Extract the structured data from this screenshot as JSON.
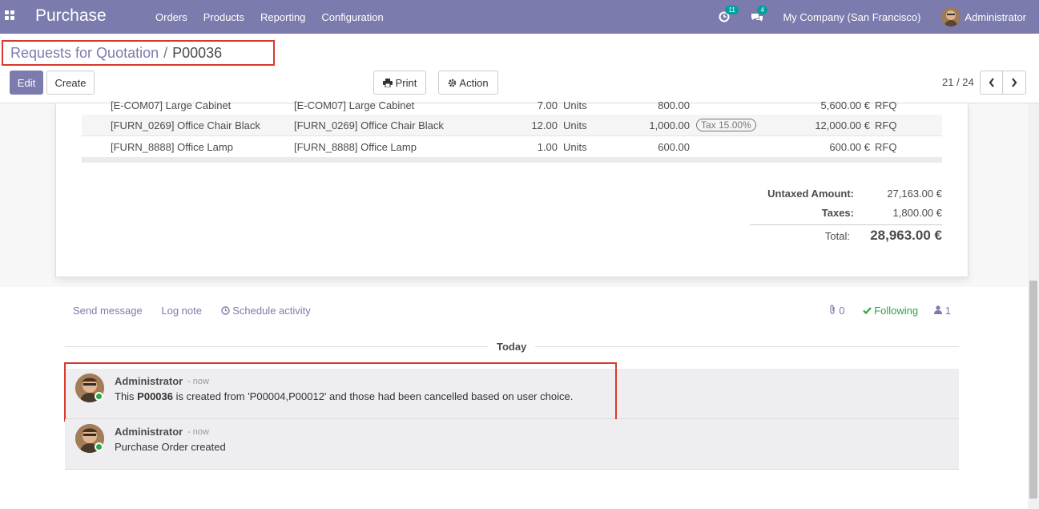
{
  "app": {
    "title": "Purchase"
  },
  "menu": [
    "Orders",
    "Products",
    "Reporting",
    "Configuration"
  ],
  "systray": {
    "activity_count": "11",
    "message_count": "4",
    "company": "My Company (San Francisco)",
    "user": "Administrator"
  },
  "breadcrumb": {
    "parent": "Requests for Quotation",
    "separator": "/",
    "current": "P00036"
  },
  "buttons": {
    "edit": "Edit",
    "create": "Create",
    "print": "Print",
    "action": "Action"
  },
  "pager": {
    "value": "21 / 24"
  },
  "order_lines": [
    {
      "product": "[E-COM07] Large Cabinet",
      "description": "[E-COM07] Large Cabinet",
      "qty": "7.00",
      "uom": "Units",
      "price": "800.00",
      "tax": "",
      "subtotal": "5,600.00 €",
      "status": "RFQ"
    },
    {
      "product": "[FURN_0269] Office Chair Black",
      "description": "[FURN_0269] Office Chair Black",
      "qty": "12.00",
      "uom": "Units",
      "price": "1,000.00",
      "tax": "Tax 15.00%",
      "subtotal": "12,000.00 €",
      "status": "RFQ"
    },
    {
      "product": "[FURN_8888] Office Lamp",
      "description": "[FURN_8888] Office Lamp",
      "qty": "1.00",
      "uom": "Units",
      "price": "600.00",
      "tax": "",
      "subtotal": "600.00 €",
      "status": "RFQ"
    }
  ],
  "totals": {
    "untaxed_label": "Untaxed Amount:",
    "untaxed_value": "27,163.00 €",
    "taxes_label": "Taxes:",
    "taxes_value": "1,800.00 €",
    "total_label": "Total:",
    "total_value": "28,963.00 €"
  },
  "chatter": {
    "send_message": "Send message",
    "log_note": "Log note",
    "schedule_activity": "Schedule activity",
    "attachments": "0",
    "following": "Following",
    "followers": "1",
    "day": "Today",
    "messages": [
      {
        "author": "Administrator",
        "date": "- now",
        "body_pre": "This ",
        "body_bold": "P00036",
        "body_post": " is created from 'P00004,P00012' and those had been cancelled based on user choice."
      },
      {
        "author": "Administrator",
        "date": "- now",
        "body": "Purchase Order created"
      }
    ]
  },
  "colors": {
    "brand": "#7c7bad",
    "highlight": "#d9382f",
    "following": "#28a745"
  }
}
